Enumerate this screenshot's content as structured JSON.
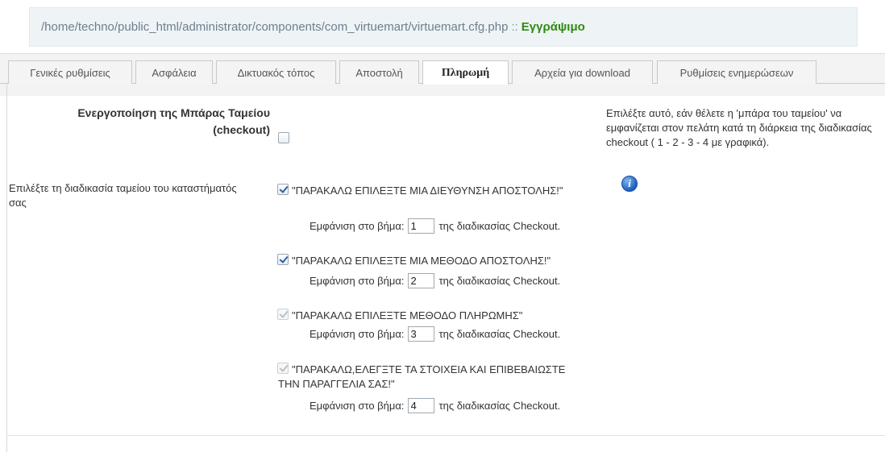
{
  "path_bar": {
    "path": "/home/techno/public_html/administrator/components/com_virtuemart/virtuemart.cfg.php",
    "separator": "::",
    "status": "Εγγράψιμο"
  },
  "tabs": [
    {
      "label": "Γενικές ρυθμίσεις",
      "active": false
    },
    {
      "label": "Ασφάλεια",
      "active": false
    },
    {
      "label": "Δικτυακός τόπος",
      "active": false
    },
    {
      "label": "Αποστολή",
      "active": false
    },
    {
      "label": "Πληρωμή",
      "active": true
    },
    {
      "label": "Αρχεία για download",
      "active": false
    },
    {
      "label": "Ρυθμίσεις ενημερώσεων",
      "active": false
    }
  ],
  "checkout_bar": {
    "label": "Ενεργοποίηση της Μπάρας Ταμείου (checkout)",
    "checked": false,
    "help": "Επιλέξτε αυτό, εάν θέλετε η 'μπάρα του ταμείου' να εμφανίζεται στον πελάτη κατά τη διάρκεια της διαδικασίας checkout ( 1 - 2 - 3 - 4 με γραφικά).",
    "info_icon": "info-icon"
  },
  "checkout_process": {
    "label": "Επιλέξτε τη διαδικασία ταμείου του καταστήματός σας",
    "show_at_step_prefix": "Εμφάνιση στο βήμα:",
    "show_at_step_suffix": "της διαδικασίας Checkout.",
    "steps": [
      {
        "title": "\"ΠΑΡΑΚΑΛΩ ΕΠΙΛΕΞΤΕ ΜΙΑ ΔΙΕΥΘΥΝΣΗ ΑΠΟΣΤΟΛΗΣ!\"",
        "checked": true,
        "disabled": false,
        "step": "1"
      },
      {
        "title": "\"ΠΑΡΑΚΑΛΩ ΕΠΙΛΕΞΤΕ ΜΙΑ ΜΕΘΟΔΟ ΑΠΟΣΤΟΛΗΣ!\"",
        "checked": true,
        "disabled": false,
        "step": "2"
      },
      {
        "title": "\"ΠΑΡΑΚΑΛΩ ΕΠΙΛΕΞΤΕ ΜΕΘΟΔΟ ΠΛΗΡΩΜΗΣ\"",
        "checked": true,
        "disabled": true,
        "step": "3"
      },
      {
        "title": "\"ΠΑΡΑΚΑΛΩ,ΕΛΕΓΞΤΕ ΤΑ ΣΤΟΙΧΕΙΑ ΚΑΙ ΕΠΙΒΕΒΑΙΩΣΤΕ ΤΗΝ ΠΑΡΑΓΓΕΛΙΑ ΣΑΣ!\"",
        "checked": true,
        "disabled": true,
        "step": "4"
      }
    ]
  }
}
